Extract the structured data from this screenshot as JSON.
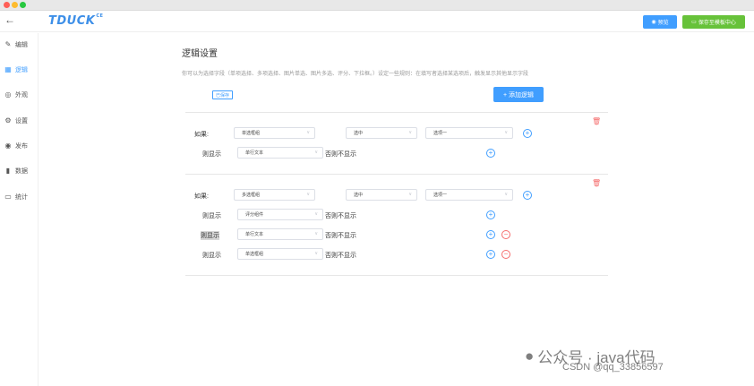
{
  "header": {
    "back_icon": "arrow-left-icon",
    "logo_text": "TDUCK",
    "logo_sup": "CE",
    "preview_label": "预览",
    "template_label": "保存至模板中心"
  },
  "sidebar": {
    "items": [
      {
        "label": "编辑",
        "icon": "pencil-icon"
      },
      {
        "label": "逻辑",
        "icon": "grid-icon"
      },
      {
        "label": "外观",
        "icon": "eye-icon"
      },
      {
        "label": "设置",
        "icon": "gear-icon"
      },
      {
        "label": "发布",
        "icon": "publish-icon"
      },
      {
        "label": "数据",
        "icon": "bar-chart-icon"
      },
      {
        "label": "统计",
        "icon": "monitor-icon"
      }
    ],
    "active_index": 1
  },
  "main": {
    "title": "逻辑设置",
    "description": "你可以为选择字段（单项选择、多项选择、图片单选、图片多选、评分、下拉框。）设定一些规则：在填写者选择某选项后，触发显示其他显示字段",
    "saved_badge": "已保存",
    "add_logic_label": "+ 添加逻辑"
  },
  "rules": [
    {
      "if_label": "如果:",
      "field": "单选框组",
      "condition": "选中",
      "option": "选项一",
      "actions": [
        {
          "label": "则显示",
          "field": "单行文本",
          "else_text": "否则不显示",
          "removable": false
        }
      ]
    },
    {
      "if_label": "如果:",
      "field": "多选框组",
      "condition": "选中",
      "option": "选项一",
      "actions": [
        {
          "label": "则显示",
          "field": "评分组件",
          "else_text": "否则不显示",
          "removable": false
        },
        {
          "label": "则显示",
          "field": "单行文本",
          "else_text": "否则不显示",
          "removable": true
        },
        {
          "label": "则显示",
          "field": "单选框组",
          "else_text": "否则不显示",
          "removable": true
        }
      ]
    }
  ],
  "watermark": {
    "line1": "公众号 · java代码",
    "line2": "CSDN @qq_33856597"
  },
  "colors": {
    "primary": "#409eff",
    "success": "#67c23a",
    "danger": "#f56c6c",
    "logo": "#3d8fe8"
  }
}
